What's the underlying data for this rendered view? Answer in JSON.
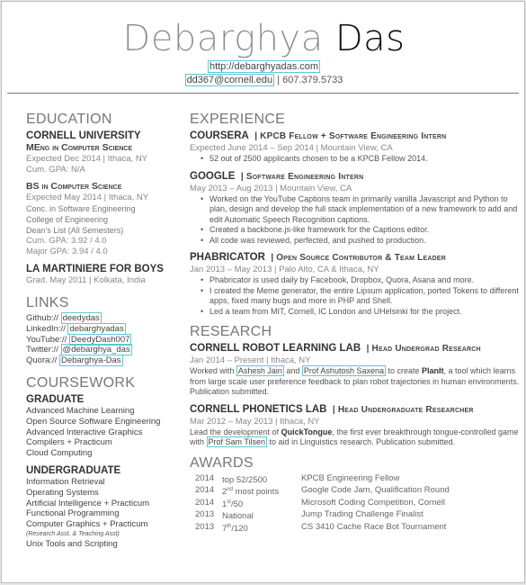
{
  "header": {
    "first_name": "Debarghya",
    "last_name": "Das",
    "website": "http://debarghyadas.com",
    "email": "dd367@cornell.edu",
    "separator": " | ",
    "phone": "607.379.5733"
  },
  "education": {
    "title": "EDUCATION",
    "cornell": {
      "name": "CORNELL UNIVERSITY",
      "meng": {
        "degree": "MEng in Computer Science",
        "dates": "Expected Dec 2014 | Ithaca, NY",
        "gpa": "Cum. GPA: N/A"
      },
      "bs": {
        "degree": "BS in Computer Science",
        "dates": "Expected May 2014 | Ithaca, NY",
        "lines": [
          "Conc. in Software Engineering",
          "College of Engineering",
          "Dean's List (All Semesters)"
        ],
        "cum_gpa": "Cum. GPA: 3.92 / 4.0",
        "major_gpa": "Major GPA: 3.94 / 4.0"
      }
    },
    "lamartiniere": {
      "name": "LA MARTINIERE FOR BOYS",
      "dates": "Grad. May 2011 | Kolkata, India"
    }
  },
  "links": {
    "title": "LINKS",
    "items": [
      {
        "label": "Github:// ",
        "value": "deedydas"
      },
      {
        "label": "LinkedIn:// ",
        "value": "debarghyadas"
      },
      {
        "label": "YouTube:// ",
        "value": "DeedyDash007"
      },
      {
        "label": "Twitter:// ",
        "value": "@debarghya_das"
      },
      {
        "label": "Quora:// ",
        "value": "Debarghya-Das"
      }
    ]
  },
  "coursework": {
    "title": "COURSEWORK",
    "graduate": {
      "title": "GRADUATE",
      "items": [
        "Advanced Machine Learning",
        "Open Source Software Engineering",
        "Advanced Interactive Graphics",
        "Compilers + Practicum",
        "Cloud Computing"
      ]
    },
    "undergraduate": {
      "title": "UNDERGRADUATE",
      "items": [
        "Information Retrieval",
        "Operating Systems",
        "Artificial Intelligence + Practicum",
        "Functional Programming",
        "Computer Graphics + Practicum"
      ],
      "note": "(Research Asst. & Teaching Asst)",
      "last": "Unix Tools and Scripting"
    }
  },
  "experience": {
    "title": "EXPERIENCE",
    "jobs": [
      {
        "org": "COURSERA",
        "role": "| KPCB Fellow + Software Engineering Intern",
        "dates": "Expected June 2014 – Sep 2014 | Mountain View, CA",
        "bullets": [
          "52 out of 2500 applicants chosen to be a KPCB Fellow 2014."
        ]
      },
      {
        "org": "GOOGLE",
        "role": "| Software Engineering Intern",
        "dates": "May 2013 – Aug 2013 | Mountain View, CA",
        "bullets": [
          "Worked on the YouTube Captions team in primarily vanilla Javascript and Python to plan, design and develop the full stack implementation of a new framework to add and edit Automatic Speech Recognition captions.",
          "Created a backbone.js-like framework for the Captions editor.",
          "All code was reviewed, perfected, and pushed to production."
        ]
      },
      {
        "org": "PHABRICATOR",
        "role": "| Open Source Contributor & Team Leader",
        "dates": "Jan 2013 – May 2013 | Palo Alto, CA & Ithaca, NY",
        "bullets": [
          "Phabricator is used daily by Facebook, Dropbox, Quora, Asana and more.",
          "I created the Meme generator, the entire Lipsum application, ported Tokens to different apps, fixed many bugs and more in PHP and Shell.",
          "Led a team from MIT, Cornell, IC London and UHelsinki for the project."
        ]
      }
    ]
  },
  "research": {
    "title": "RESEARCH",
    "labs": [
      {
        "org": "CORNELL ROBOT LEARNING LAB",
        "role": "| Head Undergrad Research",
        "dates": "Jan 2014 – Present | Ithaca, NY",
        "t1": "Worked with ",
        "link1": "Ashesh Jain",
        "t2": " and ",
        "link2": "Prof Ashutosh Saxena",
        "t3": " to create ",
        "bold": "PlanIt",
        "t4": ", a tool which learns from large scale user preference feedback to plan robot trajectories in human environments. Publication submitted."
      },
      {
        "org": "CORNELL PHONETICS LAB",
        "role": "| Head Undergraduate Researcher",
        "dates": "Mar 2012 – May 2013 | Ithaca, NY",
        "t1": "Lead the development of ",
        "bold": "QuickTongue",
        "t2": ", the first ever breakthrough tongue-controlled game with ",
        "link1": "Prof Sam Tilsen",
        "t3": " to aid in Linguistics research. Publication submitted."
      }
    ]
  },
  "awards": {
    "title": "AWARDS",
    "rows": [
      {
        "year": "2014",
        "rank": "top 52/2500",
        "rank_sup": "",
        "rank_post": "",
        "name": "KPCB Engineering Fellow"
      },
      {
        "year": "2014",
        "rank": "2",
        "rank_sup": "nd",
        "rank_post": " most points",
        "name": "Google Code Jam, Qualification Round"
      },
      {
        "year": "2014",
        "rank": "1",
        "rank_sup": "st",
        "rank_post": "/50",
        "name": "Microsoft Coding Competition, Cornell"
      },
      {
        "year": "2013",
        "rank": "National",
        "rank_sup": "",
        "rank_post": "",
        "name": "Jump Trading Challenge Finalist"
      },
      {
        "year": "2013",
        "rank": "7",
        "rank_sup": "th",
        "rank_post": "/120",
        "name": "CS 3410 Cache Race Bot Tournament"
      }
    ]
  }
}
